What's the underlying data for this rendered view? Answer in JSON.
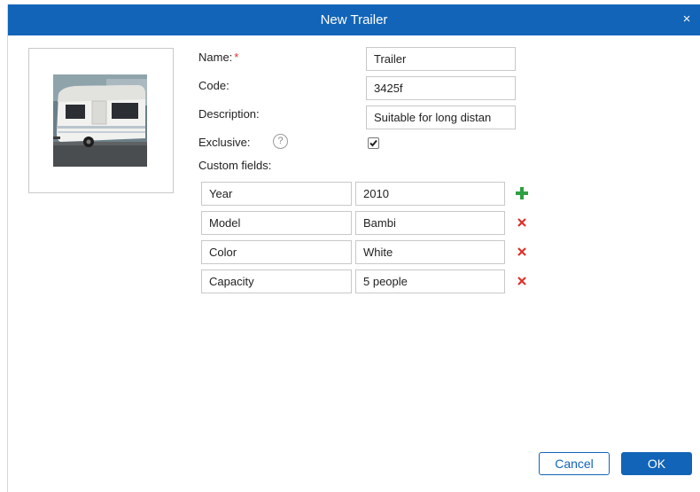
{
  "dialog": {
    "title": "New Trailer",
    "close_symbol": "×",
    "accent_color": "#1264b8"
  },
  "photo": {
    "description_icon": "trailer-photo"
  },
  "form": {
    "name_label": "Name:",
    "required_mark": "*",
    "name_value": "Trailer",
    "code_label": "Code:",
    "code_value": "3425f",
    "description_label": "Description:",
    "description_value": "Suitable for long distan",
    "exclusive_label": "Exclusive:",
    "exclusive_help": "?",
    "exclusive_checked": true,
    "custom_fields_label": "Custom fields:"
  },
  "custom_fields": [
    {
      "key": "Year",
      "value": "2010",
      "action": "add-icon"
    },
    {
      "key": "Model",
      "value": "Bambi",
      "action": "remove-icon"
    },
    {
      "key": "Color",
      "value": "White",
      "action": "remove-icon"
    },
    {
      "key": "Capacity",
      "value": "5 people",
      "action": "remove-icon"
    }
  ],
  "buttons": {
    "cancel": "Cancel",
    "ok": "OK"
  }
}
